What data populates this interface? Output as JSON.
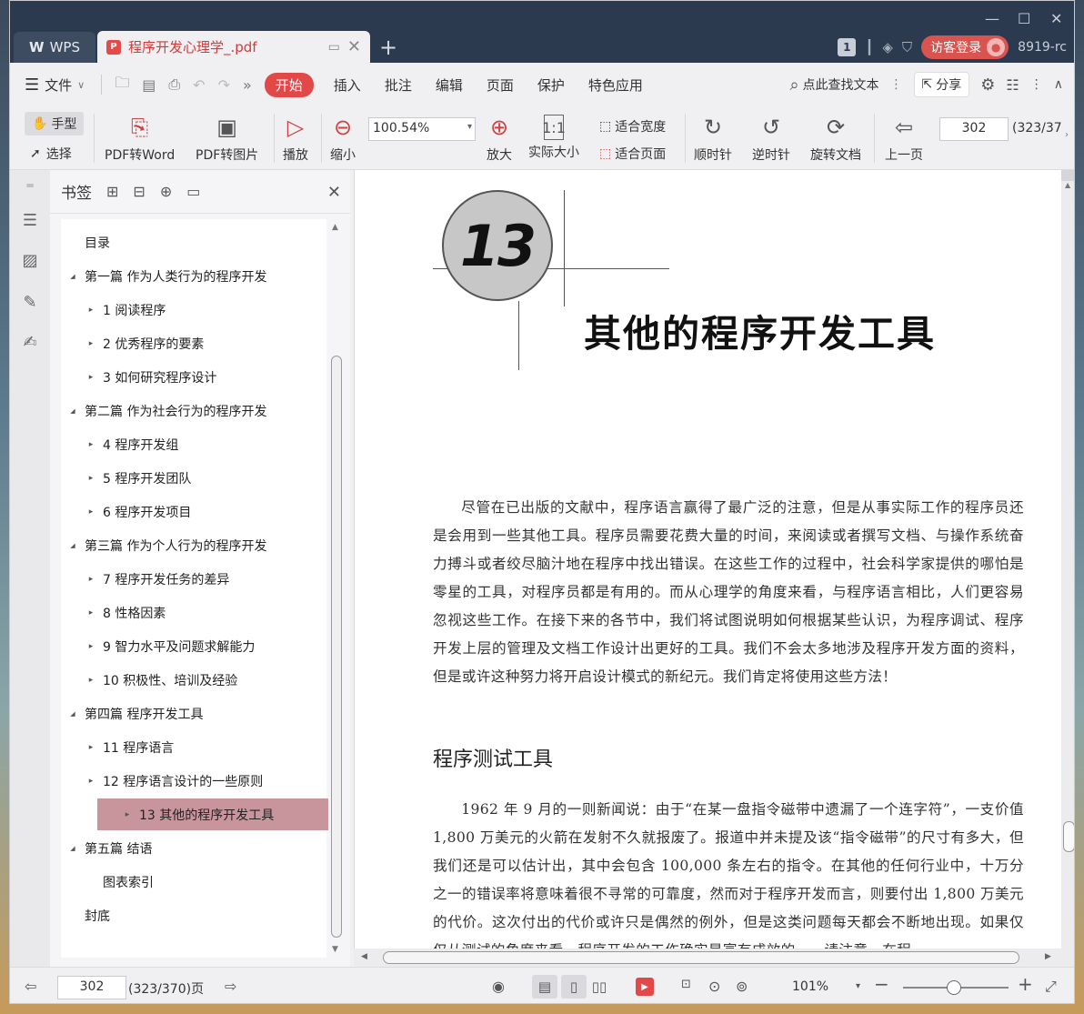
{
  "window": {
    "app_tab": "WPS",
    "doc_tab": "程序开发心理学_.pdf",
    "page_badge": "1",
    "login": "访客登录",
    "user_id": "8919-rc"
  },
  "menu": {
    "file": "文件",
    "start": "开始",
    "items": [
      "插入",
      "批注",
      "编辑",
      "页面",
      "保护",
      "特色应用"
    ],
    "search": "点此查找文本",
    "share": "分享"
  },
  "toolbar": {
    "hand": "手型",
    "select": "选择",
    "pdf_word": "PDF转Word",
    "pdf_img": "PDF转图片",
    "play": "播放",
    "zoom_out": "缩小",
    "zoom_value": "100.54%",
    "zoom_in": "放大",
    "actual": "实际大小",
    "fit_width": "适合宽度",
    "fit_page": "适合页面",
    "cw": "顺时针",
    "ccw": "逆时针",
    "rotate": "旋转文档",
    "prev": "上一页",
    "page": "302",
    "page_total": "(323/37"
  },
  "bookmarks": {
    "title": "书签",
    "items": [
      {
        "label": "目录",
        "level": 0,
        "arrow": ""
      },
      {
        "label": "第一篇  作为人类行为的程序开发",
        "level": 0,
        "arrow": "open"
      },
      {
        "label": "1  阅读程序",
        "level": 1,
        "arrow": "closed"
      },
      {
        "label": "2  优秀程序的要素",
        "level": 1,
        "arrow": "closed"
      },
      {
        "label": "3  如何研究程序设计",
        "level": 1,
        "arrow": "closed"
      },
      {
        "label": "第二篇  作为社会行为的程序开发",
        "level": 0,
        "arrow": "open"
      },
      {
        "label": "4  程序开发组",
        "level": 1,
        "arrow": "closed"
      },
      {
        "label": "5  程序开发团队",
        "level": 1,
        "arrow": "closed"
      },
      {
        "label": "6  程序开发项目",
        "level": 1,
        "arrow": "closed"
      },
      {
        "label": "第三篇  作为个人行为的程序开发",
        "level": 0,
        "arrow": "open"
      },
      {
        "label": "7  程序开发任务的差异",
        "level": 1,
        "arrow": "closed"
      },
      {
        "label": "8  性格因素",
        "level": 1,
        "arrow": "closed"
      },
      {
        "label": "9  智力水平及问题求解能力",
        "level": 1,
        "arrow": "closed"
      },
      {
        "label": "10  积极性、培训及经验",
        "level": 1,
        "arrow": "closed"
      },
      {
        "label": "第四篇  程序开发工具",
        "level": 0,
        "arrow": "open"
      },
      {
        "label": "11  程序语言",
        "level": 1,
        "arrow": "closed"
      },
      {
        "label": "12  程序语言设计的一些原则",
        "level": 1,
        "arrow": "closed"
      },
      {
        "label": "13  其他的程序开发工具",
        "level": 1,
        "arrow": "closed",
        "selected": true
      },
      {
        "label": "第五篇  结语",
        "level": 0,
        "arrow": "open"
      },
      {
        "label": "图表索引",
        "level": 1,
        "arrow": ""
      },
      {
        "label": "封底",
        "level": 0,
        "arrow": ""
      }
    ]
  },
  "document": {
    "chapter_number": "13",
    "chapter_title": "其他的程序开发工具",
    "para1": "尽管在已出版的文献中，程序语言赢得了最广泛的注意，但是从事实际工作的程序员还是会用到一些其他工具。程序员需要花费大量的时间，来阅读或者撰写文档、与操作系统奋力搏斗或者绞尽脑汁地在程序中找出错误。在这些工作的过程中，社会科学家提供的哪怕是零星的工具，对程序员都是有用的。而从心理学的角度来看，与程序语言相比，人们更容易忽视这些工作。在接下来的各节中，我们将试图说明如何根据某些认识，为程序调试、程序开发上层的管理及文档工作设计出更好的工具。我们不会太多地涉及程序开发方面的资料，但是或许这种努力将开启设计模式的新纪元。我们肯定将使用这些方法！",
    "section_title": "程序测试工具",
    "para2": "1962 年 9 月的一则新闻说：由于“在某一盘指令磁带中遗漏了一个连字符”，一支价值 1,800 万美元的火箭在发射不久就报废了。报道中并未提及该“指令磁带”的尺寸有多大，但我们还是可以估计出，其中会包含 100,000 条左右的指令。在其他的任何行业中，十万分之一的错误率将意味着很不寻常的可靠度，然而对于程序开发而言，则要付出 1,800 万美元的代价。这次付出的代价或许只是偶然的例外，但是这类问题每天都会不断地出现。如果仅仅从测试的角度来看，程序开发的工作确实是富有成效的——请注意，在程"
  },
  "status": {
    "page": "302",
    "page_total": "(323/370)页",
    "zoom": "101%"
  }
}
